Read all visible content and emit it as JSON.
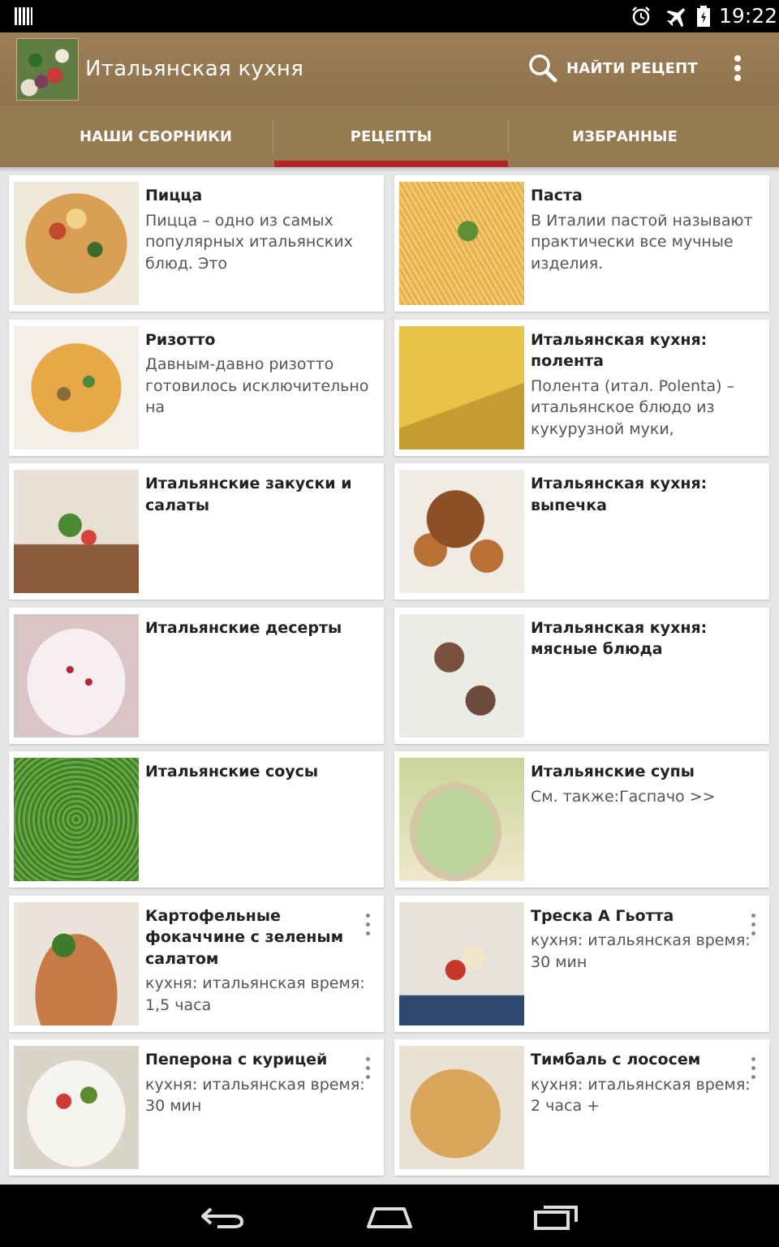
{
  "status_bar": {
    "time": "19:22",
    "icons": [
      "signal-icon",
      "alarm-icon",
      "airplane-mode-icon",
      "battery-icon"
    ]
  },
  "app_bar": {
    "title": "Итальянская кухня",
    "search_label": "НАЙТИ РЕЦЕПТ",
    "icons": [
      "app-logo",
      "search-icon",
      "overflow-menu-icon"
    ]
  },
  "tabs": [
    {
      "label": "НАШИ СБОРНИКИ",
      "selected": false
    },
    {
      "label": "РЕЦЕПТЫ",
      "selected": true
    },
    {
      "label": "ИЗБРАННЫЕ",
      "selected": false
    }
  ],
  "colors": {
    "app_bar": "#9c7f58",
    "tab_bar": "#967a52",
    "tab_indicator": "#b5262b",
    "background": "#e6e6e6"
  },
  "cards": [
    {
      "title": "Пицца",
      "desc": "Пицца – одно из самых популярных итальянских блюд. Это",
      "menu": false
    },
    {
      "title": "Паста",
      "desc": "В Италии пастой называют практически все мучные изделия.",
      "menu": false
    },
    {
      "title": "Ризотто",
      "desc": "Давным-давно ризотто готовилось исключительно на",
      "menu": false
    },
    {
      "title": "Итальянская кухня: полента",
      "desc": "Полента (итал. Polenta) – итальянское блюдо из кукурузной муки,",
      "menu": false
    },
    {
      "title": "Итальянские закуски и салаты",
      "desc": "",
      "menu": false
    },
    {
      "title": "Итальянская кухня: выпечка",
      "desc": "",
      "menu": false
    },
    {
      "title": "Итальянские десерты",
      "desc": "",
      "menu": false
    },
    {
      "title": "Итальянская кухня: мясные блюда",
      "desc": "",
      "menu": false
    },
    {
      "title": "Итальянские соусы",
      "desc": "",
      "menu": false
    },
    {
      "title": "Итальянские супы",
      "desc": "См. также:Гаспачо >>",
      "menu": false
    },
    {
      "title": "Картофельные фокаччине с зеленым салатом",
      "desc": "кухня: итальянская время: 1,5 часа",
      "menu": true
    },
    {
      "title": "Треска А Гьотта",
      "desc": "кухня: итальянская время: 30 мин",
      "menu": true
    },
    {
      "title": "Пеперона с курицей",
      "desc": "кухня: итальянская время: 30 мин",
      "menu": true
    },
    {
      "title": "Тимбаль с лососем",
      "desc": "кухня: итальянская время: 2 часа +",
      "menu": true
    }
  ],
  "nav_bar": {
    "icons": [
      "back-icon",
      "home-icon",
      "recents-icon"
    ]
  }
}
